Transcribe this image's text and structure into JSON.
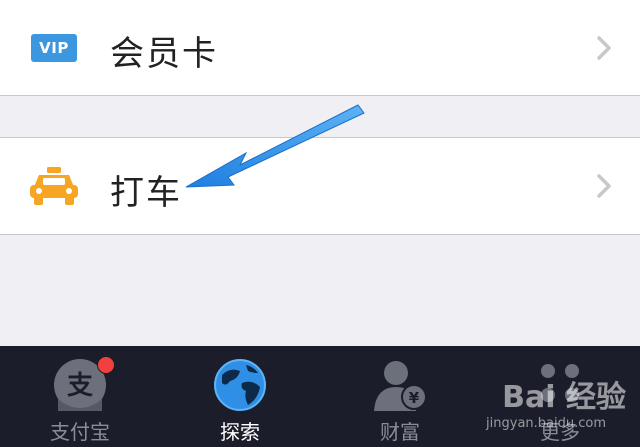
{
  "menu": {
    "vip": {
      "icon_text": "VIP",
      "label": "会员卡",
      "icon": "vip-card-icon"
    },
    "taxi": {
      "label": "打车",
      "icon": "taxi-icon"
    }
  },
  "tabbar": {
    "tabs": [
      {
        "label": "支付宝",
        "icon": "alipay-icon"
      },
      {
        "label": "探索",
        "icon": "globe-icon"
      },
      {
        "label": "财富",
        "icon": "wealth-icon"
      },
      {
        "label": "更多",
        "icon": "more-icon"
      }
    ],
    "active_index": 1
  },
  "watermark": {
    "text": "Bai 经验",
    "sub": "jingyan.baidu.com"
  },
  "colors": {
    "accent_blue": "#3a97e0",
    "taxi_orange": "#f6a622",
    "tabbar_bg": "#1b1e2a",
    "badge_red": "#f24040",
    "arrow_blue": "#2c8fe8"
  }
}
